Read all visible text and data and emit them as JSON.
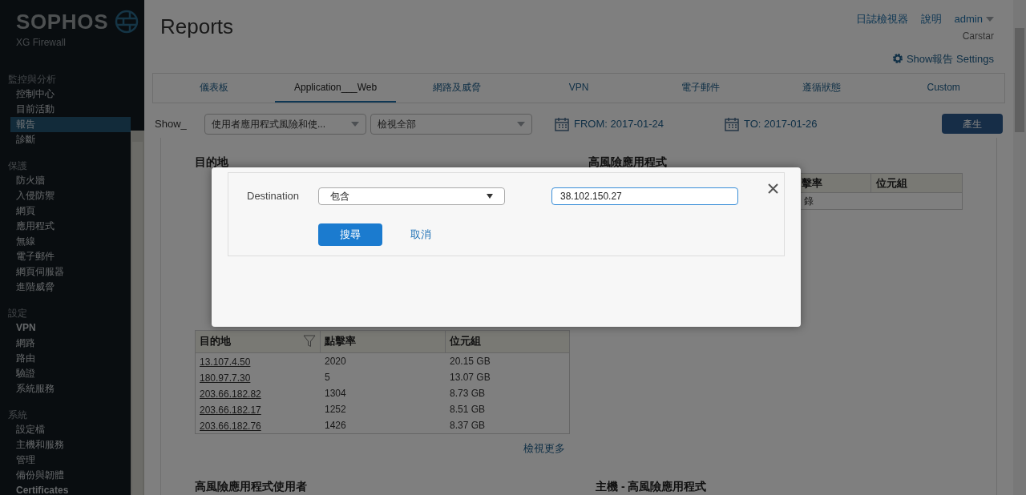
{
  "brand": {
    "name": "SOPHOS",
    "product": "XG Firewall"
  },
  "sidebar": {
    "sections": [
      {
        "title": "監控與分析",
        "items": [
          {
            "label": "控制中心",
            "selected": false,
            "bold": false
          },
          {
            "label": "目前活動",
            "selected": false,
            "bold": false
          },
          {
            "label": "報告",
            "selected": true,
            "bold": false
          },
          {
            "label": "診斷",
            "selected": false,
            "bold": false
          }
        ]
      },
      {
        "title": "保護",
        "items": [
          {
            "label": "防火牆",
            "selected": false,
            "bold": false
          },
          {
            "label": "入侵防禦",
            "selected": false,
            "bold": false
          },
          {
            "label": "網頁",
            "selected": false,
            "bold": false
          },
          {
            "label": "應用程式",
            "selected": false,
            "bold": false
          },
          {
            "label": "無線",
            "selected": false,
            "bold": false
          },
          {
            "label": "電子郵件",
            "selected": false,
            "bold": false
          },
          {
            "label": "網頁伺服器",
            "selected": false,
            "bold": false
          },
          {
            "label": "進階威脅",
            "selected": false,
            "bold": false
          }
        ]
      },
      {
        "title": "設定",
        "items": [
          {
            "label": "VPN",
            "selected": false,
            "bold": true
          },
          {
            "label": "網路",
            "selected": false,
            "bold": false
          },
          {
            "label": "路由",
            "selected": false,
            "bold": false
          },
          {
            "label": "驗證",
            "selected": false,
            "bold": false
          },
          {
            "label": "系統服務",
            "selected": false,
            "bold": false
          }
        ]
      },
      {
        "title": "系統",
        "items": [
          {
            "label": "設定檔",
            "selected": false,
            "bold": false
          },
          {
            "label": "主機和服務",
            "selected": false,
            "bold": false
          },
          {
            "label": "管理",
            "selected": false,
            "bold": false
          },
          {
            "label": "備份與韌體",
            "selected": false,
            "bold": false
          },
          {
            "label": "Certificates",
            "selected": false,
            "bold": true
          }
        ]
      }
    ]
  },
  "header": {
    "title": "Reports",
    "links": [
      "日誌檢視器",
      "說明"
    ],
    "user": "admin",
    "org": "Carstar",
    "settings": "Show報告 Settings"
  },
  "tabs": [
    {
      "label": "儀表板",
      "selected": false
    },
    {
      "label": "Application___Web",
      "selected": true
    },
    {
      "label": "網路及威脅",
      "selected": false
    },
    {
      "label": "VPN",
      "selected": false
    },
    {
      "label": "電子郵件",
      "selected": false
    },
    {
      "label": "遵循狀態",
      "selected": false
    },
    {
      "label": "Custom",
      "selected": false
    }
  ],
  "filters": {
    "show_label": "Show_",
    "report_select": "使用者應用程式風險和使...",
    "view_select": "檢視全部",
    "from": "FROM: 2017-01-24",
    "to": "TO: 2017-01-26",
    "generate": "產生"
  },
  "widgets": {
    "left_title": "目的地",
    "right_title": "高風險應用程式",
    "right_table": {
      "columns": [
        "擊率",
        "位元組"
      ],
      "rows": [
        [
          "錄"
        ]
      ]
    },
    "left_table": {
      "columns": [
        "目的地",
        "點擊率",
        "位元組"
      ],
      "rows": [
        [
          "13.107.4.50",
          "2020",
          "20.15 GB"
        ],
        [
          "180.97.7.30",
          "5",
          "13.07 GB"
        ],
        [
          "203.66.182.82",
          "1304",
          "8.73 GB"
        ],
        [
          "203.66.182.17",
          "1252",
          "8.51 GB"
        ],
        [
          "203.66.182.76",
          "1426",
          "8.37 GB"
        ]
      ]
    },
    "view_more": "檢視更多",
    "bottom_left_title": "高風險應用程式使用者",
    "bottom_right_title": "主機 - 高風險應用程式"
  },
  "dialog": {
    "field_label": "Destination",
    "operator": "包含",
    "value": "38.102.150.27",
    "search": "搜尋",
    "cancel": "取消"
  }
}
